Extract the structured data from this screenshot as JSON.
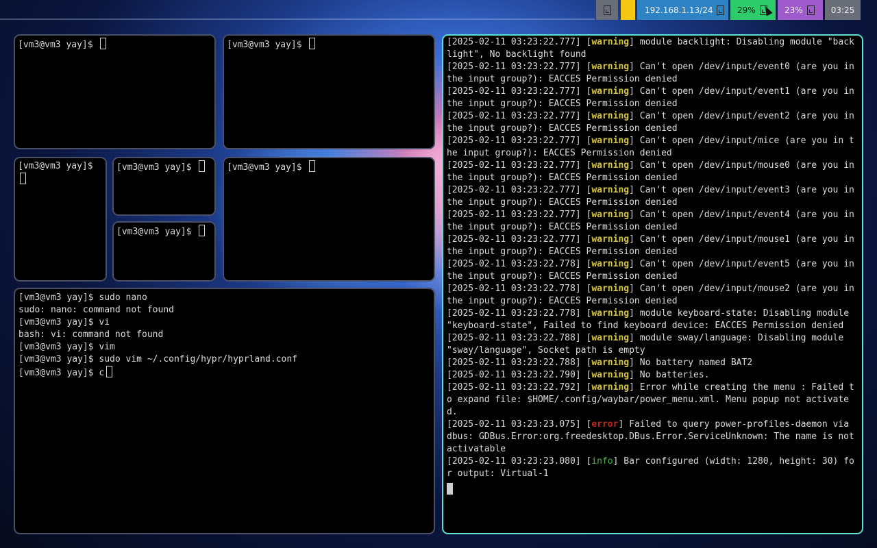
{
  "topbar": {
    "network": "192.168.1.13/24",
    "cpu": "29%",
    "memory": "23%",
    "clock": "03:25",
    "colors": {
      "network": "#2d83c4",
      "cpu": "#2dcc6b",
      "memory": "#a05bcc",
      "neutral": "#6a6e78",
      "yellow": "#f5c612"
    }
  },
  "terminals": {
    "t1": {
      "lines": [
        {
          "text": "[vm3@vm3 yay]$ ",
          "cursor": true
        }
      ]
    },
    "t2": {
      "lines": [
        {
          "text": "[vm3@vm3 yay]$ ",
          "cursor": true
        }
      ]
    },
    "t3": {
      "lines": [
        {
          "text": "[vm3@vm3 yay]$ ",
          "cursor": true
        }
      ]
    },
    "t4": {
      "lines": [
        {
          "text": "[vm3@vm3 yay]$ ",
          "cursor": true
        }
      ]
    },
    "t5": {
      "lines": [
        {
          "text": "[vm3@vm3 yay]$ ",
          "cursor": true
        }
      ]
    },
    "t6": {
      "lines": [
        {
          "text": "[vm3@vm3 yay]$ ",
          "cursor": true
        }
      ]
    },
    "t7": {
      "lines": [
        {
          "text": "[vm3@vm3 yay]$ sudo nano"
        },
        {
          "text": "sudo: nano: command not found"
        },
        {
          "text": "[vm3@vm3 yay]$ vi"
        },
        {
          "text": "bash: vi: command not found"
        },
        {
          "text": "[vm3@vm3 yay]$ vim"
        },
        {
          "text": "[vm3@vm3 yay]$ sudo vim ~/.config/hypr/hyprland.conf"
        },
        {
          "text": "[vm3@vm3 yay]$ c",
          "cursor": true
        }
      ]
    },
    "log": {
      "entries": [
        {
          "ts": "[2025-02-11 03:23:22.777]",
          "level": "warning",
          "msg": "module backlight: Disabling module \"backlight\", No backlight found"
        },
        {
          "ts": "[2025-02-11 03:23:22.777]",
          "level": "warning",
          "msg": "Can't open /dev/input/event0 (are you in the input group?): EACCES Permission denied"
        },
        {
          "ts": "[2025-02-11 03:23:22.777]",
          "level": "warning",
          "msg": "Can't open /dev/input/event1 (are you in the input group?): EACCES Permission denied"
        },
        {
          "ts": "[2025-02-11 03:23:22.777]",
          "level": "warning",
          "msg": "Can't open /dev/input/event2 (are you in the input group?): EACCES Permission denied"
        },
        {
          "ts": "[2025-02-11 03:23:22.777]",
          "level": "warning",
          "msg": "Can't open /dev/input/mice (are you in the input group?): EACCES Permission denied"
        },
        {
          "ts": "[2025-02-11 03:23:22.777]",
          "level": "warning",
          "msg": "Can't open /dev/input/mouse0 (are you in the input group?): EACCES Permission denied"
        },
        {
          "ts": "[2025-02-11 03:23:22.777]",
          "level": "warning",
          "msg": "Can't open /dev/input/event3 (are you in the input group?): EACCES Permission denied"
        },
        {
          "ts": "[2025-02-11 03:23:22.777]",
          "level": "warning",
          "msg": "Can't open /dev/input/event4 (are you in the input group?): EACCES Permission denied"
        },
        {
          "ts": "[2025-02-11 03:23:22.777]",
          "level": "warning",
          "msg": "Can't open /dev/input/mouse1 (are you in the input group?): EACCES Permission denied"
        },
        {
          "ts": "[2025-02-11 03:23:22.778]",
          "level": "warning",
          "msg": "Can't open /dev/input/event5 (are you in the input group?): EACCES Permission denied"
        },
        {
          "ts": "[2025-02-11 03:23:22.778]",
          "level": "warning",
          "msg": "Can't open /dev/input/mouse2 (are you in the input group?): EACCES Permission denied"
        },
        {
          "ts": "[2025-02-11 03:23:22.778]",
          "level": "warning",
          "msg": "module keyboard-state: Disabling module \"keyboard-state\", Failed to find keyboard device: EACCES Permission denied"
        },
        {
          "ts": "[2025-02-11 03:23:22.788]",
          "level": "warning",
          "msg": "module sway/language: Disabling module \"sway/language\", Socket path is empty"
        },
        {
          "ts": "[2025-02-11 03:23:22.788]",
          "level": "warning",
          "msg": "No battery named BAT2"
        },
        {
          "ts": "[2025-02-11 03:23:22.790]",
          "level": "warning",
          "msg": "No batteries."
        },
        {
          "ts": "[2025-02-11 03:23:22.792]",
          "level": "warning",
          "msg": "Error while creating the menu : Failed to expand file: $HOME/.config/waybar/power_menu.xml. Menu popup not activated."
        },
        {
          "ts": "[2025-02-11 03:23:23.075]",
          "level": "error",
          "msg": "Failed to query power-profiles-daemon via dbus: GDBus.Error:org.freedesktop.DBus.Error.ServiceUnknown: The name is not activatable"
        },
        {
          "ts": "[2025-02-11 03:23:23.080]",
          "level": "info",
          "msg": "Bar configured (width: 1280, height: 30) for output: Virtual-1"
        }
      ]
    }
  }
}
